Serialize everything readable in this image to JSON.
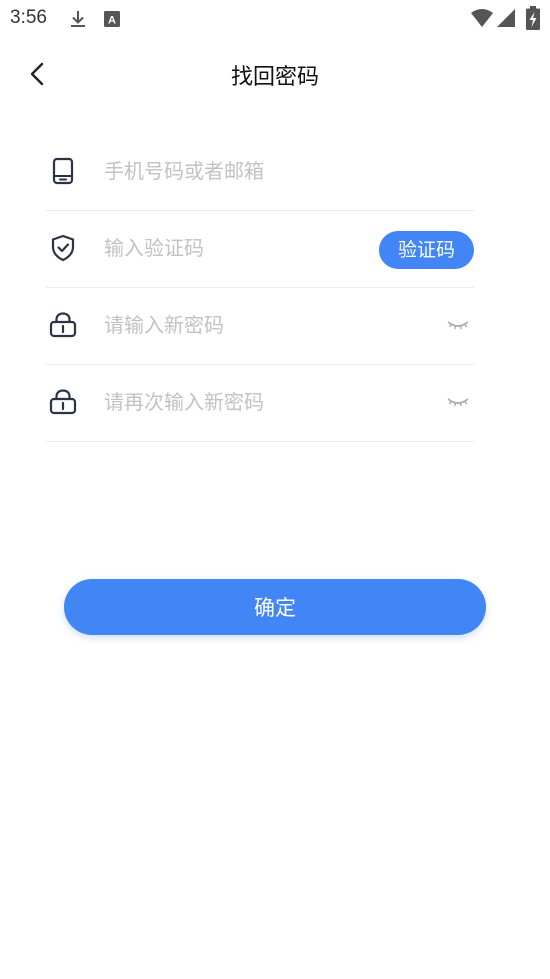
{
  "status_bar": {
    "time": "3:56",
    "left_icons": [
      "download-icon",
      "font-app-icon"
    ],
    "right_icons": [
      "wifi-icon",
      "signal-icon",
      "battery-charging-icon"
    ]
  },
  "header": {
    "title": "找回密码",
    "back_icon": "chevron-left-icon"
  },
  "form": {
    "phone": {
      "placeholder": "手机号码或者邮箱",
      "value": "",
      "icon": "phone-icon"
    },
    "code": {
      "placeholder": "输入验证码",
      "value": "",
      "icon": "shield-check-icon",
      "button_label": "验证码"
    },
    "new_password": {
      "placeholder": "请输入新密码",
      "value": "",
      "icon": "lock-icon",
      "toggle_icon": "eye-closed-icon"
    },
    "confirm_password": {
      "placeholder": "请再次输入新密码",
      "value": "",
      "icon": "lock-icon",
      "toggle_icon": "eye-closed-icon"
    }
  },
  "submit_label": "确定",
  "colors": {
    "accent": "#4285f4",
    "placeholder": "#c2c2c2",
    "divider": "#ececec",
    "icon": "#2b3348"
  }
}
